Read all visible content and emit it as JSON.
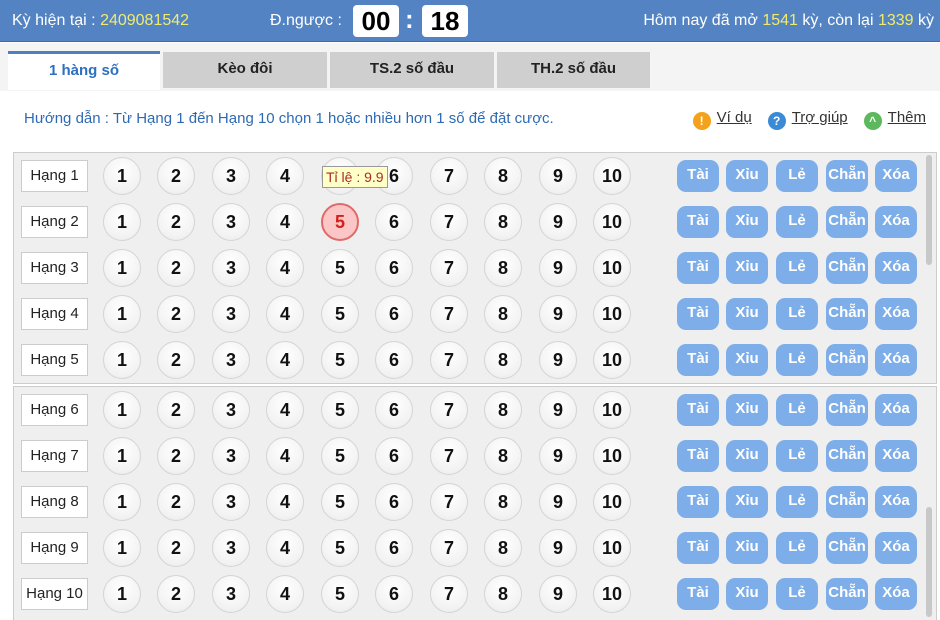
{
  "header": {
    "current_label": "Kỳ hiện tại  :",
    "current_value": "2409081542",
    "countdown_label": "Đ.ngược :",
    "minutes": "00",
    "seconds": "18",
    "today_prefix": "Hôm nay đã mở",
    "opened": "1541",
    "today_mid": "kỳ, còn lại",
    "remaining": "1339",
    "today_suffix": "kỳ"
  },
  "tabs": [
    {
      "label": "1 hàng số",
      "active": true
    },
    {
      "label": "Kèo đôi"
    },
    {
      "label": "TS.2 số đầu"
    },
    {
      "label": "TH.2 số đầu"
    }
  ],
  "guide": "Hướng dẫn : Từ Hạng 1 đến Hạng 10 chọn 1 hoặc nhiều hơn 1 số để đặt cược.",
  "links": [
    {
      "label": "Ví dụ",
      "icon": "warning-icon",
      "color": "#f4a21c",
      "glyph": "!"
    },
    {
      "label": "Trợ giúp",
      "icon": "help-icon",
      "color": "#3a8ad6",
      "glyph": "?"
    },
    {
      "label": "Thêm",
      "icon": "chevron-up-icon",
      "color": "#5cb85c",
      "glyph": "^"
    }
  ],
  "rows": [
    "Hạng 1",
    "Hạng 2",
    "Hạng 3",
    "Hạng 4",
    "Hạng 5",
    "Hạng 6",
    "Hạng 7",
    "Hạng 8",
    "Hạng 9",
    "Hạng 10"
  ],
  "numbers": [
    "1",
    "2",
    "3",
    "4",
    "5",
    "6",
    "7",
    "8",
    "9",
    "10"
  ],
  "quick_buttons": [
    "Tài",
    "Xỉu",
    "Lẻ",
    "Chẵn",
    "Xóa"
  ],
  "selected": [
    {
      "row": "Hạng 2",
      "number": "5"
    }
  ],
  "tooltip": "Tỉ lệ : 9.9",
  "colors": {
    "header": "#5383c3",
    "accent_yellow": "#f0ec6a",
    "quick_button": "#7daee9",
    "selected": "#e06a6a"
  }
}
